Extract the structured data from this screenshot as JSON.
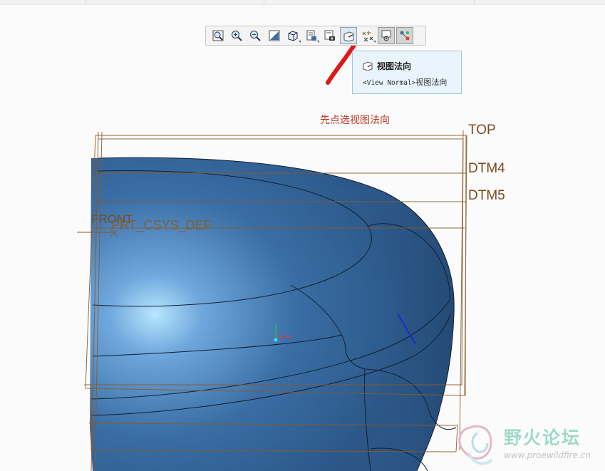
{
  "toolbar": {
    "buttons": [
      {
        "icon": "zoom-to-fit-icon"
      },
      {
        "icon": "zoom-in-icon"
      },
      {
        "icon": "zoom-out-icon"
      },
      {
        "icon": "repaint-icon"
      },
      {
        "icon": "display-style-icon"
      },
      {
        "icon": "saved-orientations-icon"
      },
      {
        "icon": "view-manager-icon"
      },
      {
        "icon": "view-normal-icon"
      },
      {
        "icon": "datum-display-filters-icon"
      },
      {
        "icon": "annotation-display-icon"
      },
      {
        "icon": "spin-center-icon"
      }
    ]
  },
  "tooltip": {
    "title": "视图法向",
    "desc_code": "<View Normal>",
    "desc_text": "视图法向"
  },
  "annotation": "先点选视图法向",
  "datum_planes": {
    "top": "TOP",
    "dtm4": "DTM4",
    "dtm5": "DTM5",
    "front": "FRONT",
    "csys": "PRT_CSYS_DEF"
  },
  "watermark": {
    "name": "野火论坛",
    "url": "www.proewildfire.cn"
  },
  "colors": {
    "model_blue": "#3a6ea5",
    "datum_brown": "#8b5a2b",
    "annotation_red": "#c0392b",
    "tooltip_bg": "#eaf4fc"
  }
}
